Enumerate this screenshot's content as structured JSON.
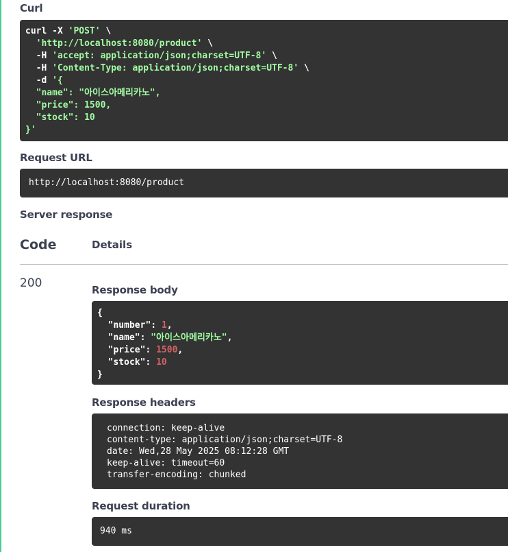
{
  "curl": {
    "label": "Curl",
    "lines": [
      [
        "curl -X ",
        "'POST'",
        " \\"
      ],
      [
        "  ",
        "'http://localhost:8080/product'",
        " \\"
      ],
      [
        "  -H ",
        "'accept: application/json;charset=UTF-8'",
        " \\"
      ],
      [
        "  -H ",
        "'Content-Type: application/json;charset=UTF-8'",
        " \\"
      ],
      [
        "  -d ",
        "'{",
        ""
      ],
      [
        "  ",
        "\"name\": \"아이스아메리카노\",",
        ""
      ],
      [
        "  ",
        "\"price\": 1500,",
        ""
      ],
      [
        "  ",
        "\"stock\": 10",
        ""
      ],
      [
        "",
        "}'",
        ""
      ]
    ]
  },
  "request_url": {
    "label": "Request URL",
    "value": "http://localhost:8080/product"
  },
  "server_response": {
    "label": "Server response",
    "code_header": "Code",
    "details_header": "Details",
    "status_code": "200",
    "response_body": {
      "label": "Response body",
      "open": "{",
      "close": "}",
      "fields": [
        {
          "key": "\"number\"",
          "value": "1",
          "type": "number",
          "comma": ","
        },
        {
          "key": "\"name\"",
          "value": "\"아이스아메리카노\"",
          "type": "string",
          "comma": ","
        },
        {
          "key": "\"price\"",
          "value": "1500",
          "type": "number",
          "comma": ","
        },
        {
          "key": "\"stock\"",
          "value": "10",
          "type": "number",
          "comma": ""
        }
      ]
    },
    "response_headers": {
      "label": "Response headers",
      "lines": [
        "connection: keep-alive",
        "content-type: application/json;charset=UTF-8",
        "date: Wed,28 May 2025 08:12:28 GMT",
        "keep-alive: timeout=60",
        "transfer-encoding: chunked"
      ]
    },
    "request_duration": {
      "label": "Request duration",
      "value": "940 ms"
    }
  },
  "colors": {
    "panel_bg": "#333333",
    "string": "#a2fca2",
    "number": "#d36363",
    "accent_rule": "#49cc90",
    "text": "#3b4151"
  }
}
